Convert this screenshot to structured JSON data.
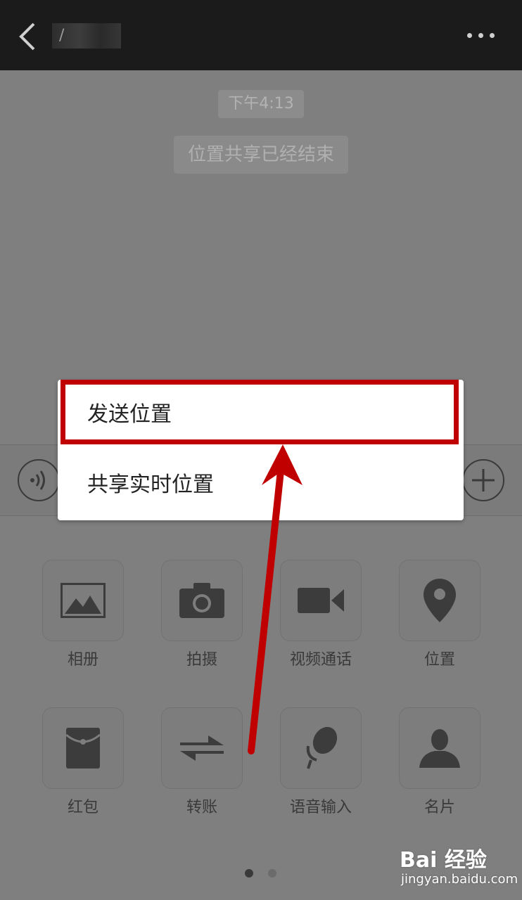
{
  "header": {
    "title": "/"
  },
  "chat": {
    "timestamp": "下午4:13",
    "system_message": "位置共享已经结束"
  },
  "popup_menu": {
    "items": [
      {
        "label": "发送位置",
        "highlighted": true
      },
      {
        "label": "共享实时位置",
        "highlighted": false
      }
    ]
  },
  "panel": {
    "items": [
      {
        "label": "相册",
        "icon": "photo-album-icon"
      },
      {
        "label": "拍摄",
        "icon": "camera-icon"
      },
      {
        "label": "视频通话",
        "icon": "video-call-icon"
      },
      {
        "label": "位置",
        "icon": "location-pin-icon"
      },
      {
        "label": "红包",
        "icon": "red-packet-icon"
      },
      {
        "label": "转账",
        "icon": "transfer-icon"
      },
      {
        "label": "语音输入",
        "icon": "microphone-icon"
      },
      {
        "label": "名片",
        "icon": "contact-card-icon"
      }
    ],
    "page_count": 2,
    "current_page": 1
  },
  "watermark": {
    "brand": "Bai 经验",
    "url": "jingyan.baidu.com"
  },
  "colors": {
    "topbar": "#1b1b1b",
    "overlay": "#7f7f7f",
    "highlight": "#c00000",
    "icon": "#3c3c3c"
  }
}
